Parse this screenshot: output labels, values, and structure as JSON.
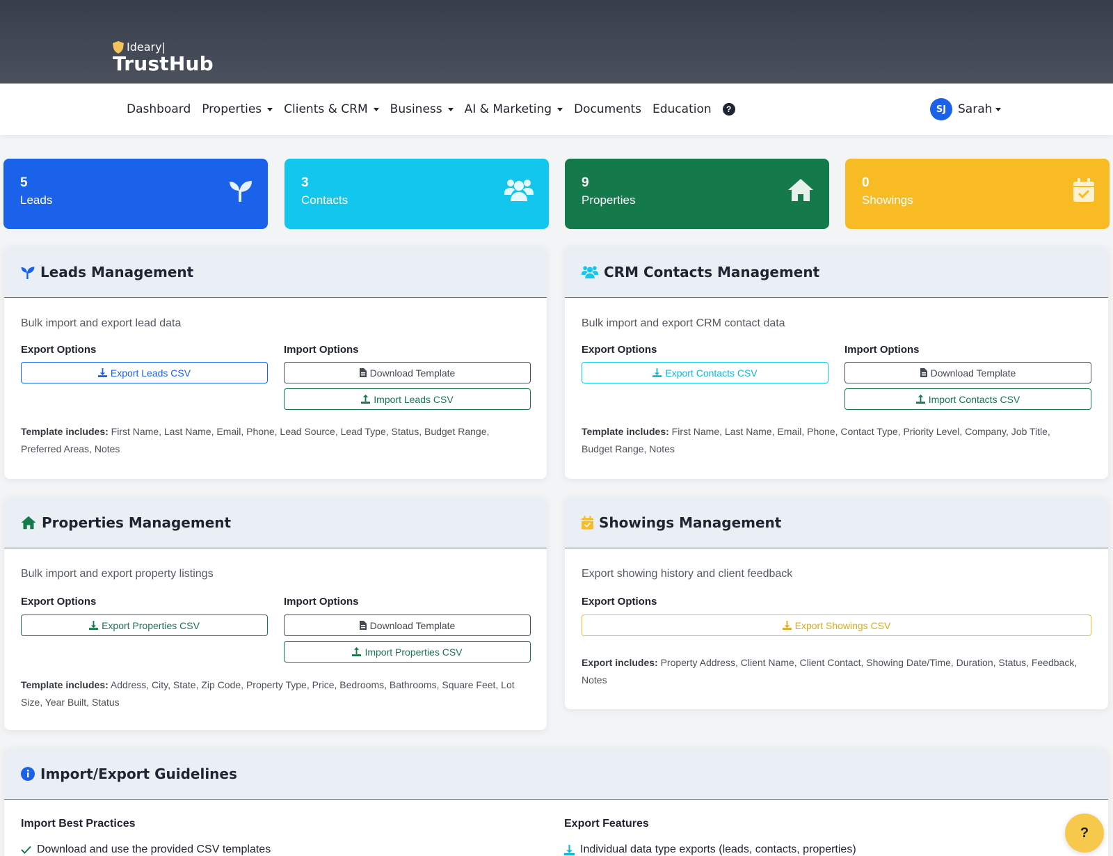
{
  "brand": {
    "sub": "Ideary|",
    "name": "TrustHub"
  },
  "nav": {
    "items": [
      {
        "label": "Dashboard"
      },
      {
        "label": "Properties"
      },
      {
        "label": "Clients & CRM"
      },
      {
        "label": "Business"
      },
      {
        "label": "AI & Marketing"
      },
      {
        "label": "Documents"
      },
      {
        "label": "Education"
      }
    ],
    "help_glyph": "?"
  },
  "user": {
    "initials": "SJ",
    "name": "Sarah"
  },
  "stats": [
    {
      "value": "5",
      "label": "Leads",
      "color": "#1a62ea",
      "icon": "seedling-icon"
    },
    {
      "value": "3",
      "label": "Contacts",
      "color": "#12c6ee",
      "icon": "users-icon"
    },
    {
      "value": "9",
      "label": "Properties",
      "color": "#157a4b",
      "icon": "home-icon"
    },
    {
      "value": "0",
      "label": "Showings",
      "color": "#f8bb24",
      "icon": "calendar-check-icon"
    }
  ],
  "leads": {
    "title": "Leads Management",
    "desc": "Bulk import and export lead data",
    "export_title": "Export Options",
    "import_title": "Import Options",
    "export_btn": "Export Leads CSV",
    "template_btn": "Download Template",
    "import_btn": "Import Leads CSV",
    "note_label": "Template includes:",
    "note_text": " First Name, Last Name, Email, Phone, Lead Source, Lead Type, Status, Budget Range, Preferred Areas, Notes"
  },
  "contacts": {
    "title": "CRM Contacts Management",
    "desc": "Bulk import and export CRM contact data",
    "export_title": "Export Options",
    "import_title": "Import Options",
    "export_btn": "Export Contacts CSV",
    "template_btn": "Download Template",
    "import_btn": "Import Contacts CSV",
    "note_label": "Template includes:",
    "note_text": " First Name, Last Name, Email, Phone, Contact Type, Priority Level, Company, Job Title, Budget Range, Notes"
  },
  "properties": {
    "title": "Properties Management",
    "desc": "Bulk import and export property listings",
    "export_title": "Export Options",
    "import_title": "Import Options",
    "export_btn": "Export Properties CSV",
    "template_btn": "Download Template",
    "import_btn": "Import Properties CSV",
    "note_label": "Template includes:",
    "note_text": " Address, City, State, Zip Code, Property Type, Price, Bedrooms, Bathrooms, Square Feet, Lot Size, Year Built, Status"
  },
  "showings": {
    "title": "Showings Management",
    "desc": "Export showing history and client feedback",
    "export_title": "Export Options",
    "export_btn": "Export Showings CSV",
    "note_label": "Export includes:",
    "note_text": " Property Address, Client Name, Client Contact, Showing Date/Time, Duration, Status, Feedback, Notes"
  },
  "guidelines": {
    "title": "Import/Export Guidelines",
    "import_title": "Import Best Practices",
    "import_item": "Download and use the provided CSV templates",
    "export_title": "Export Features",
    "export_item": "Individual data type exports (leads, contacts, properties)"
  },
  "fab": {
    "glyph": "?"
  }
}
